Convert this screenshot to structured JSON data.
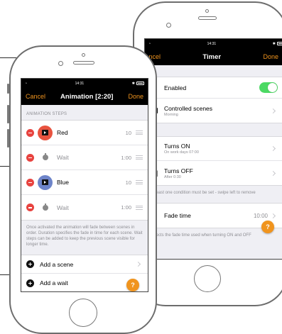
{
  "colors": {
    "accent": "#f0941e",
    "destructive": "#e8433f",
    "toggle_on": "#4cd964",
    "scene_red": "#e8533f",
    "scene_blue": "#6d84c9"
  },
  "animation_screen": {
    "status": {
      "time": "14:31"
    },
    "nav": {
      "cancel": "Cancel",
      "title": "Animation [2:20]",
      "done": "Done"
    },
    "section_header": "ANIMATION STEPS",
    "steps": [
      {
        "kind": "scene",
        "label": "Red",
        "value": "10",
        "color": "#e8533f",
        "icon": "tv-icon"
      },
      {
        "kind": "wait",
        "label": "Wait",
        "value": "1:00",
        "icon": "timer-icon"
      },
      {
        "kind": "scene",
        "label": "Blue",
        "value": "10",
        "color": "#6d84c9",
        "icon": "tv-icon"
      },
      {
        "kind": "wait",
        "label": "Wait",
        "value": "1:00",
        "icon": "timer-icon"
      }
    ],
    "footer_note": "Once activated the animation will fade between scenes in order. Duration specifies the fade in time for each scene. Wait steps can be added to keep the previous scene visible for longer time.",
    "actions": [
      {
        "label": "Add a scene",
        "icon": "plus-circle-icon"
      },
      {
        "label": "Add a wait",
        "icon": "plus-circle-icon"
      }
    ],
    "help": "?"
  },
  "timer_screen": {
    "status": {
      "time": "14:31"
    },
    "nav": {
      "cancel": "Cancel",
      "title": "Timer",
      "done": "Done"
    },
    "enabled": {
      "label": "Enabled",
      "on": true,
      "icon": "power-icon"
    },
    "controlled_scenes": {
      "label": "Controlled scenes",
      "sub": "Morning",
      "icon": "monitor-icon"
    },
    "turns_on": {
      "label": "Turns ON",
      "sub": "On work days 07:00",
      "icon": "arrow-right-icon"
    },
    "turns_off": {
      "label": "Turns OFF",
      "sub": "After 0:30",
      "icon": "arrow-right-bar-icon"
    },
    "conditions_note": "At least one condition must be set - swipe left to remove",
    "fade_time": {
      "label": "Fade time",
      "value": "10:00",
      "icon": "fade-icon"
    },
    "fade_note": "Selects the fade time used when turning ON and OFF",
    "help": "?"
  }
}
